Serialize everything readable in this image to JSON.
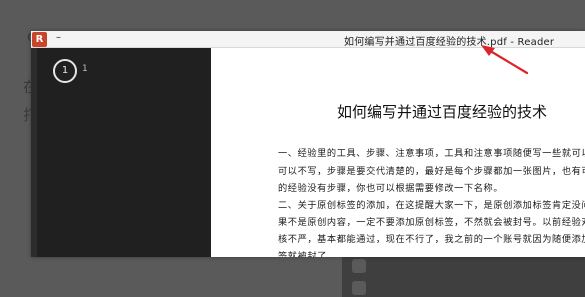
{
  "background": {
    "glyph_1": "在",
    "glyph_2": "打",
    "glyph_3": "q"
  },
  "window": {
    "app_icon_label": "R",
    "title_dash": "–",
    "title": "如何编写并通过百度经验的技术.pdf - Reader"
  },
  "sidebar": {
    "thumbnails": [
      {
        "number": "1",
        "label": "1"
      }
    ]
  },
  "document": {
    "title": "如何编写并通过百度经验的技术",
    "lines": [
      "一、经验里的工具、步骤、注意事项，工具和注意事项随便写一些就可以了，也",
      "可以不写，步骤是要交代清楚的，最好是每个步骤都加一张图片，也有可能你写",
      "的经验没有步骤，你也可以根据需要修改一下名称。",
      "二、关于原创标签的添加，在这提醒大家一下，是原创添加标签肯定没问题，如",
      "果不是原创内容，一定不要添加原创标签，不然就会被封号。以前经验对这块审",
      "核不严，基本都能通过，现在不行了，我之前的一个账号就因为随便添加原创标",
      "签就被封了。"
    ]
  },
  "colors": {
    "annotation_arrow": "#d9252b",
    "app_icon": "#c8442b"
  }
}
